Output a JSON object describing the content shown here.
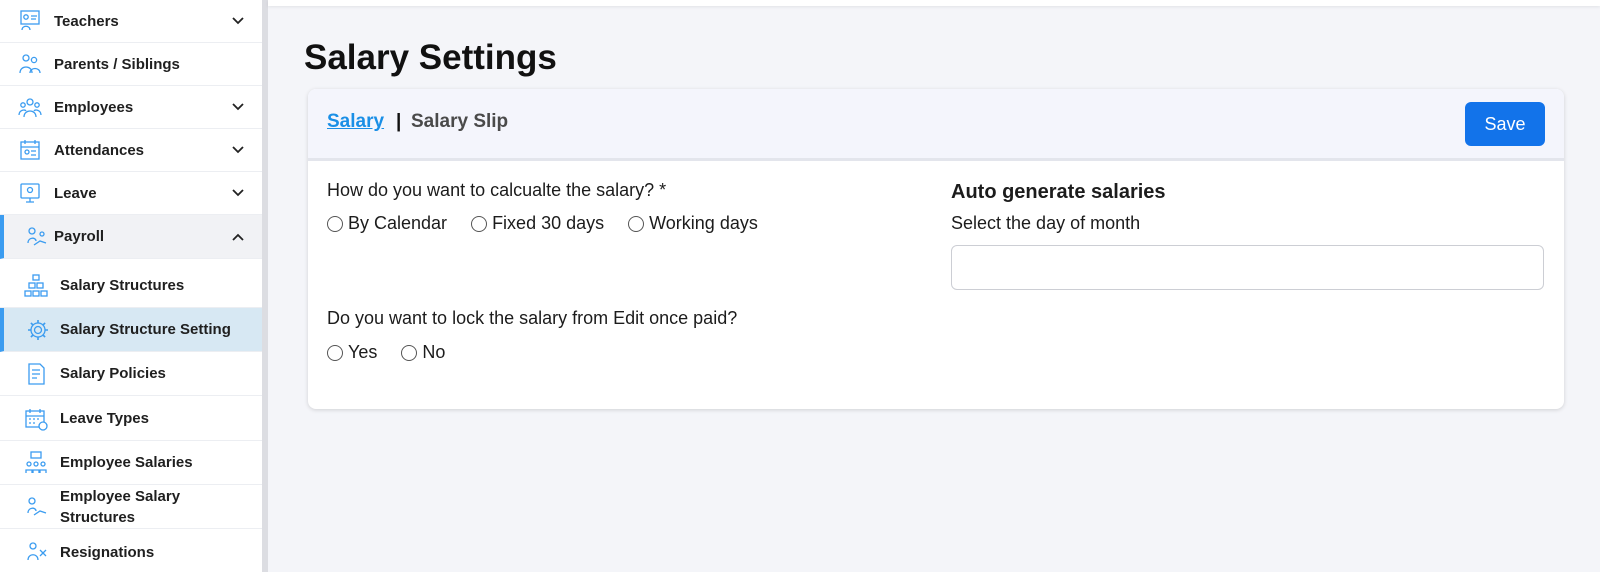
{
  "sidebar": {
    "items": [
      {
        "label": "Teachers",
        "icon": "teachers-icon",
        "expandable": true
      },
      {
        "label": "Parents / Siblings",
        "icon": "parents-icon",
        "expandable": false
      },
      {
        "label": "Employees",
        "icon": "employees-icon",
        "expandable": true
      },
      {
        "label": "Attendances",
        "icon": "attendances-icon",
        "expandable": true
      },
      {
        "label": "Leave",
        "icon": "leave-icon",
        "expandable": true
      },
      {
        "label": "Payroll",
        "icon": "payroll-icon",
        "expandable": true,
        "expanded": true
      }
    ],
    "payroll_items": [
      {
        "label": "Salary Structures",
        "icon": "org-chart-icon"
      },
      {
        "label": "Salary Structure Setting",
        "icon": "gear-icon",
        "active": true
      },
      {
        "label": "Salary Policies",
        "icon": "policy-document-icon"
      },
      {
        "label": "Leave Types",
        "icon": "calendar-icon"
      },
      {
        "label": "Employee Salaries",
        "icon": "team-salary-icon"
      },
      {
        "label": "Employee Salary Structures",
        "icon": "salary-structure-icon"
      },
      {
        "label": "Resignations",
        "icon": "resignation-icon"
      }
    ]
  },
  "page": {
    "title": "Salary Settings"
  },
  "card": {
    "tabs": {
      "salary": "Salary",
      "separator": "|",
      "salary_slip": "Salary Slip"
    },
    "save_label": "Save",
    "calc_question": "How do you want to calcualte the salary? *",
    "calc_options": [
      "By Calendar",
      "Fixed 30 days",
      "Working days"
    ],
    "lock_question": "Do you want to lock the salary from Edit once paid?",
    "lock_options": [
      "Yes",
      "No"
    ],
    "auto_title": "Auto generate salaries",
    "day_label": "Select the day of month",
    "day_value": ""
  },
  "colors": {
    "accent": "#1273ea",
    "link": "#1a8fe6",
    "active_bg": "#d7e8f3",
    "active_border": "#3b9cf0",
    "icon": "#3b9cf0"
  }
}
